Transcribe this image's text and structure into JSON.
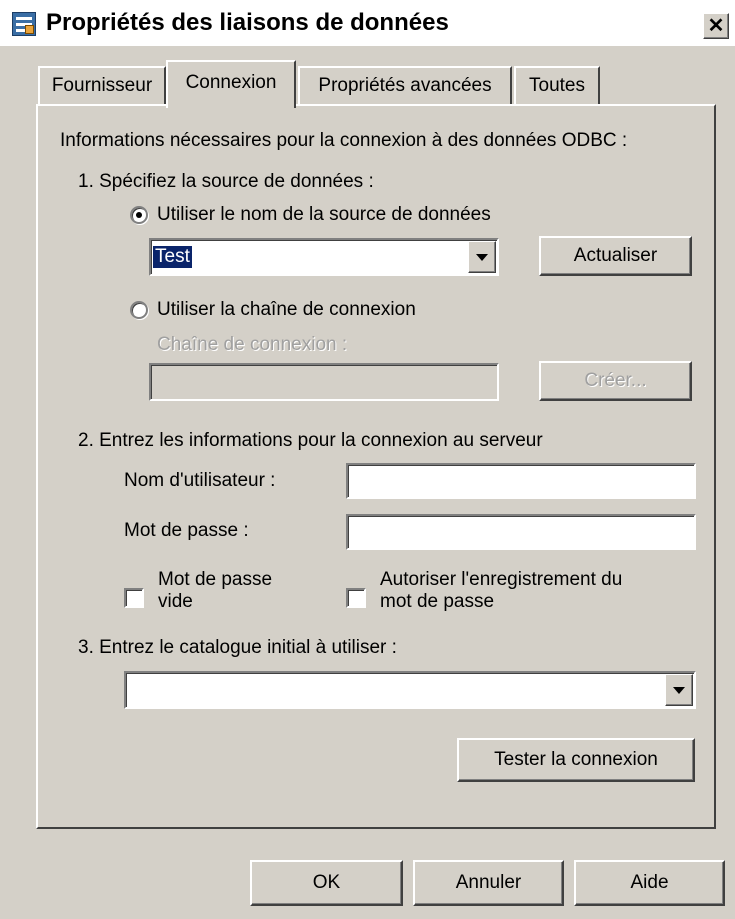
{
  "window": {
    "title": "Propriétés des liaisons de données",
    "close_label": "✕"
  },
  "tabs": [
    {
      "label": "Fournisseur",
      "active": false
    },
    {
      "label": "Connexion",
      "active": true
    },
    {
      "label": "Propriétés avancées",
      "active": false
    },
    {
      "label": "Toutes",
      "active": false
    }
  ],
  "connection": {
    "intro": "Informations nécessaires pour la connexion à des données ODBC :",
    "step1": {
      "label": "1. Spécifiez la source de données :",
      "option_dsn": {
        "label": "Utiliser le nom de la source de données",
        "selected": true
      },
      "dsn_value": "Test",
      "refresh_label": "Actualiser",
      "option_connstring": {
        "label": "Utiliser la chaîne de connexion",
        "selected": false
      },
      "connstring_label": "Chaîne de connexion :",
      "connstring_value": "",
      "build_label": "Créer..."
    },
    "step2": {
      "label": "2. Entrez les informations pour la connexion au serveur",
      "username_label": "Nom d'utilisateur :",
      "username_value": "",
      "password_label": "Mot de passe :",
      "password_value": "",
      "blank_password": {
        "line1": "Mot de passe",
        "line2": "vide",
        "checked": false
      },
      "allow_saving": {
        "line1": "Autoriser l'enregistrement du",
        "line2": "mot de passe",
        "checked": false
      }
    },
    "step3": {
      "label": "3. Entrez le catalogue initial à utiliser :",
      "catalog_value": ""
    },
    "test_label": "Tester la connexion"
  },
  "footer": {
    "ok_label": "OK",
    "cancel_label": "Annuler",
    "help_label": "Aide"
  }
}
